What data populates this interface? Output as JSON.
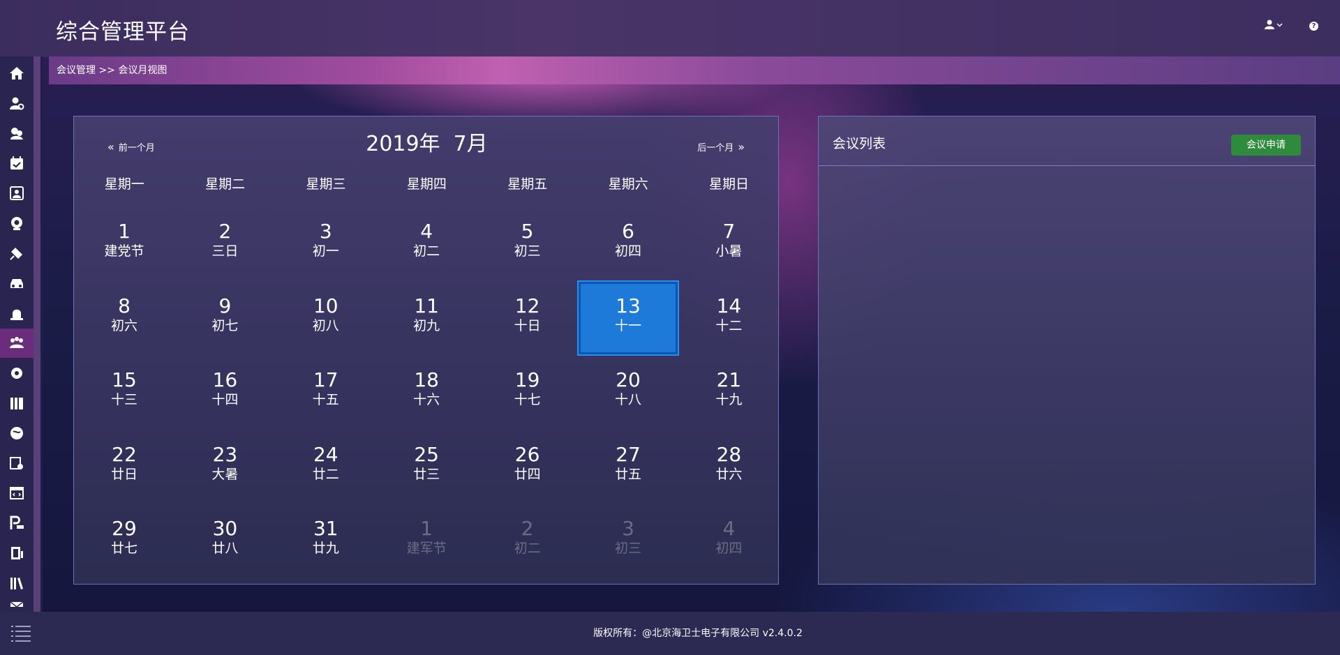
{
  "header": {
    "app_title": "综合管理平台"
  },
  "breadcrumb": {
    "text": "会议管理 >> 会议月视图"
  },
  "calendar": {
    "title": "2019年  7月",
    "prev_label": "前一个月",
    "next_label": "后一个月",
    "weekdays": [
      "星期一",
      "星期二",
      "星期三",
      "星期四",
      "星期五",
      "星期六",
      "星期日"
    ],
    "selected_day": 13,
    "rows": [
      [
        {
          "n": "1",
          "l": "建党节"
        },
        {
          "n": "2",
          "l": "三日"
        },
        {
          "n": "3",
          "l": "初一"
        },
        {
          "n": "4",
          "l": "初二"
        },
        {
          "n": "5",
          "l": "初三"
        },
        {
          "n": "6",
          "l": "初四"
        },
        {
          "n": "7",
          "l": "小暑"
        }
      ],
      [
        {
          "n": "8",
          "l": "初六"
        },
        {
          "n": "9",
          "l": "初七"
        },
        {
          "n": "10",
          "l": "初八"
        },
        {
          "n": "11",
          "l": "初九"
        },
        {
          "n": "12",
          "l": "十日"
        },
        {
          "n": "13",
          "l": "十一"
        },
        {
          "n": "14",
          "l": "十二"
        }
      ],
      [
        {
          "n": "15",
          "l": "十三"
        },
        {
          "n": "16",
          "l": "十四"
        },
        {
          "n": "17",
          "l": "十五"
        },
        {
          "n": "18",
          "l": "十六"
        },
        {
          "n": "19",
          "l": "十七"
        },
        {
          "n": "20",
          "l": "十八"
        },
        {
          "n": "21",
          "l": "十九"
        }
      ],
      [
        {
          "n": "22",
          "l": "廿日"
        },
        {
          "n": "23",
          "l": "大暑"
        },
        {
          "n": "24",
          "l": "廿二"
        },
        {
          "n": "25",
          "l": "廿三"
        },
        {
          "n": "26",
          "l": "廿四"
        },
        {
          "n": "27",
          "l": "廿五"
        },
        {
          "n": "28",
          "l": "廿六"
        }
      ],
      [
        {
          "n": "29",
          "l": "廿七"
        },
        {
          "n": "30",
          "l": "廿八"
        },
        {
          "n": "31",
          "l": "廿九"
        },
        {
          "n": "1",
          "l": "建军节",
          "other": true
        },
        {
          "n": "2",
          "l": "初二",
          "other": true
        },
        {
          "n": "3",
          "l": "初三",
          "other": true
        },
        {
          "n": "4",
          "l": "初四",
          "other": true
        }
      ]
    ]
  },
  "meeting_list": {
    "title": "会议列表",
    "apply_button": "会议申请"
  },
  "footer": {
    "copyright": "版权所有：@北京海卫士电子有限公司 v2.4.0.2"
  },
  "sidebar": {
    "items": [
      {
        "icon": "home-icon"
      },
      {
        "icon": "user-settings-icon"
      },
      {
        "icon": "user-group-icon"
      },
      {
        "icon": "calendar-check-icon"
      },
      {
        "icon": "contact-card-icon"
      },
      {
        "icon": "webcam-icon"
      },
      {
        "icon": "satellite-icon"
      },
      {
        "icon": "car-icon"
      },
      {
        "icon": "alarm-light-icon"
      },
      {
        "icon": "meeting-icon",
        "active": true
      },
      {
        "icon": "gear-shield-icon"
      },
      {
        "icon": "book-shelf-icon"
      },
      {
        "icon": "globe-icon"
      },
      {
        "icon": "document-settings-icon"
      },
      {
        "icon": "code-window-icon"
      },
      {
        "icon": "parking-icon"
      },
      {
        "icon": "door-icon"
      },
      {
        "icon": "books-icon"
      },
      {
        "icon": "mail-icon"
      }
    ],
    "accent": "#6a2d7e"
  },
  "colors": {
    "selected_day": "#1e7ad8",
    "apply_button": "#2e8b3c"
  }
}
